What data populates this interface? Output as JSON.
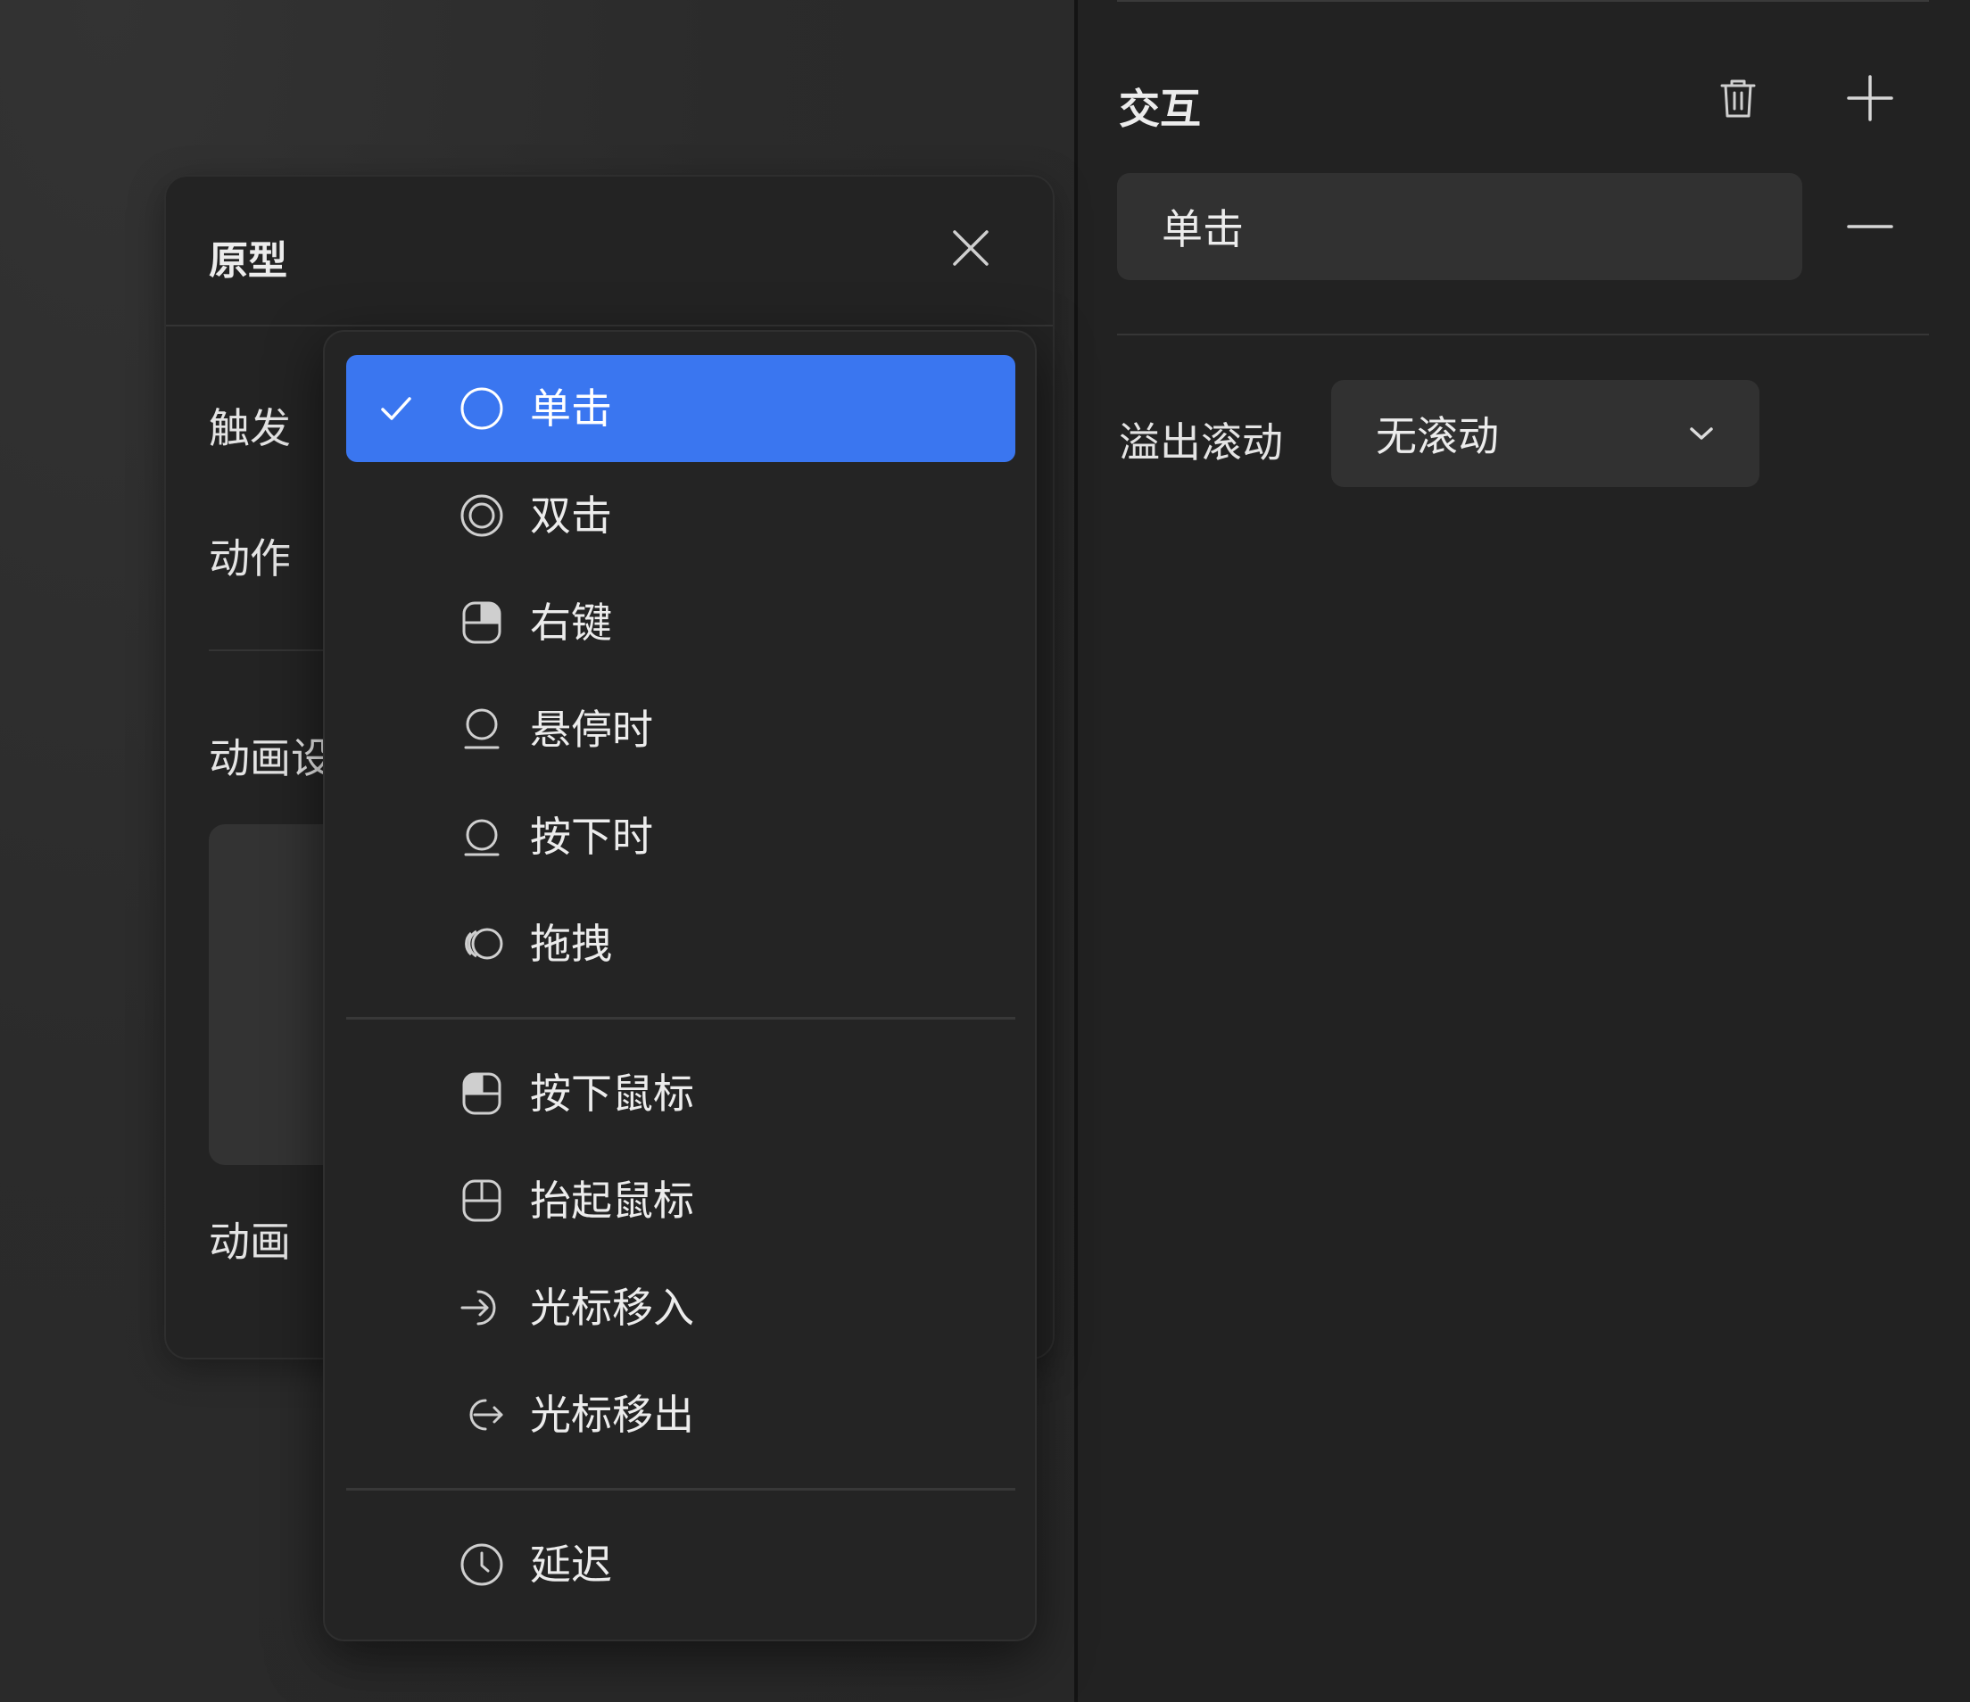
{
  "right_panel": {
    "title": "交互",
    "trash_icon": "trash-icon",
    "plus_icon": "plus-icon",
    "minus_icon": "minus-icon",
    "trigger_chip": "单击",
    "overflow_label": "溢出滚动",
    "overflow_select": {
      "value": "无滚动",
      "icon": "chevron-down-icon"
    }
  },
  "proto": {
    "title": "原型",
    "close_icon": "close-icon",
    "labels": {
      "trigger": "触发",
      "action": "动作",
      "anim_settings": "动画设",
      "animation": "动画"
    }
  },
  "menu": {
    "accent": "#3a76f0",
    "groups": [
      [
        {
          "label": "单击",
          "icon": "circle-icon",
          "selected": true
        },
        {
          "label": "双击",
          "icon": "double-circle-icon",
          "selected": false
        },
        {
          "label": "右键",
          "icon": "mouse-right-icon",
          "selected": false
        },
        {
          "label": "悬停时",
          "icon": "hover-icon",
          "selected": false
        },
        {
          "label": "按下时",
          "icon": "press-icon",
          "selected": false
        },
        {
          "label": "拖拽",
          "icon": "drag-icon",
          "selected": false
        }
      ],
      [
        {
          "label": "按下鼠标",
          "icon": "mouse-down-icon",
          "selected": false
        },
        {
          "label": "抬起鼠标",
          "icon": "mouse-up-icon",
          "selected": false
        },
        {
          "label": "光标移入",
          "icon": "cursor-enter-icon",
          "selected": false
        },
        {
          "label": "光标移出",
          "icon": "cursor-exit-icon",
          "selected": false
        }
      ],
      [
        {
          "label": "延迟",
          "icon": "clock-icon",
          "selected": false
        }
      ]
    ]
  }
}
